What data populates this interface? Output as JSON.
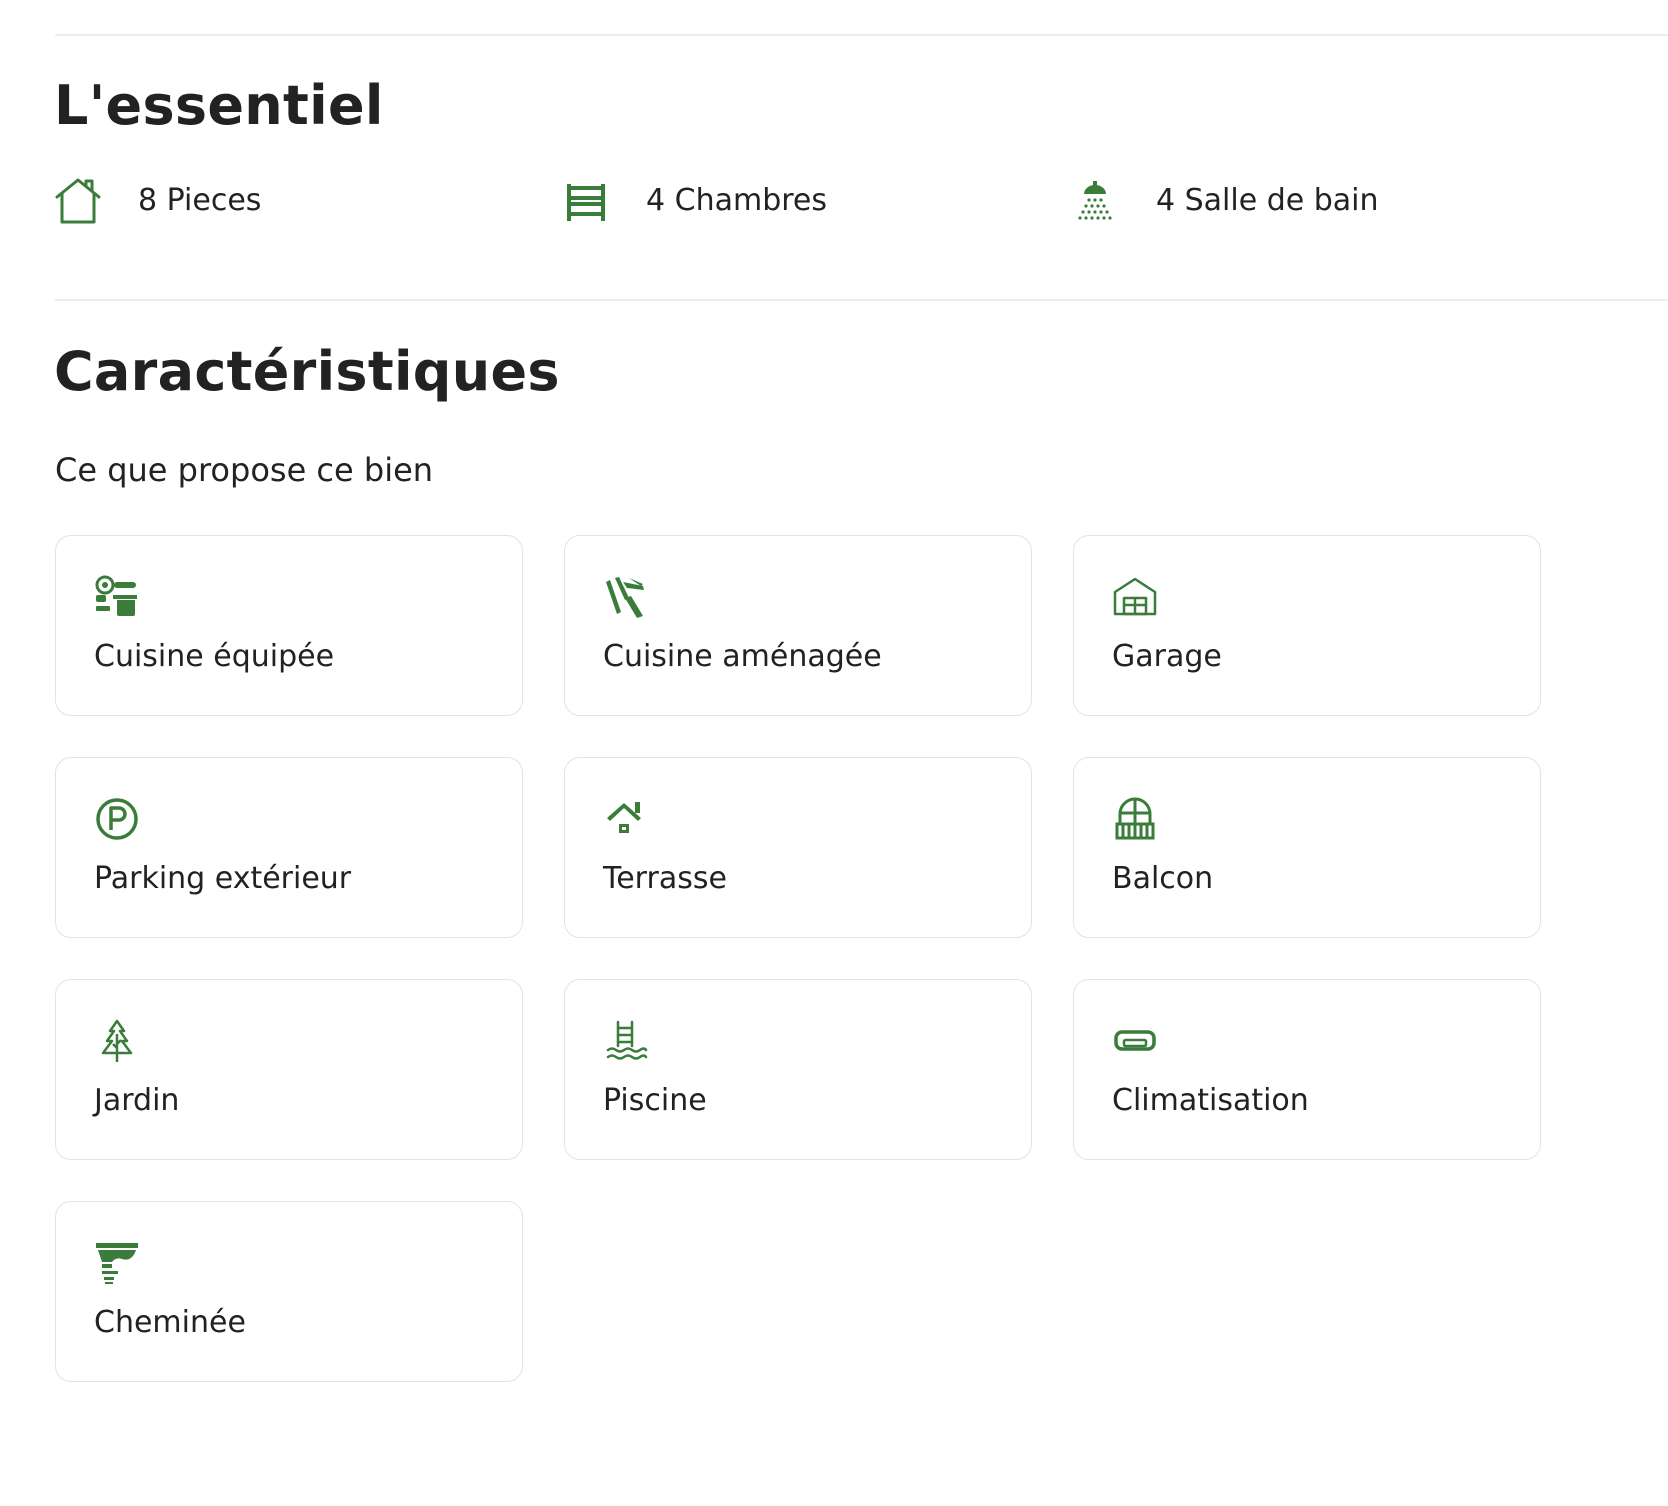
{
  "colors": {
    "accent": "#3a7d3a",
    "text": "#222222",
    "border": "#e3e3e3",
    "divider": "#ededed"
  },
  "essentiel": {
    "title": "L'essentiel",
    "stats": [
      {
        "icon": "house-icon",
        "label": "8 Pieces"
      },
      {
        "icon": "bed-icon",
        "label": "4 Chambres"
      },
      {
        "icon": "shower-icon",
        "label": "4 Salle de bain"
      }
    ]
  },
  "caracteristiques": {
    "title": "Caractéristiques",
    "subtitle": "Ce que propose ce bien",
    "features": [
      {
        "icon": "kitchen-appliances-icon",
        "label": "Cuisine équipée"
      },
      {
        "icon": "kitchen-utensils-icon",
        "label": "Cuisine aménagée"
      },
      {
        "icon": "garage-icon",
        "label": "Garage"
      },
      {
        "icon": "parking-icon",
        "label": "Parking extérieur"
      },
      {
        "icon": "roof-terrace-icon",
        "label": "Terrasse"
      },
      {
        "icon": "balcony-icon",
        "label": "Balcon"
      },
      {
        "icon": "tree-icon",
        "label": "Jardin"
      },
      {
        "icon": "pool-ladder-icon",
        "label": "Piscine"
      },
      {
        "icon": "air-conditioner-icon",
        "label": "Climatisation"
      },
      {
        "icon": "fireplace-icon",
        "label": "Cheminée"
      }
    ]
  }
}
